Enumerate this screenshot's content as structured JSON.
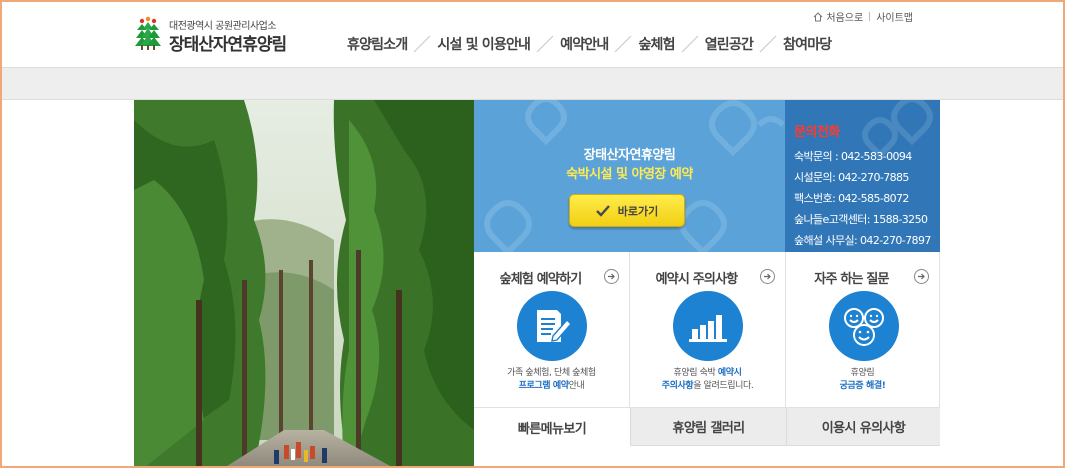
{
  "header": {
    "org_subtitle": "대전광역시 공원관리사업소",
    "site_title": "장태산자연휴양림",
    "util_links": {
      "home": "처음으로",
      "sitemap": "사이트맵"
    },
    "nav": [
      "휴양림소개",
      "시설 및 이용안내",
      "예약안내",
      "숲체험",
      "열린공간",
      "참여마당"
    ]
  },
  "reservation_banner": {
    "line1": "장태산자연휴양림",
    "line2": "숙박시설 및 야영장 예약",
    "button_label": "바로가기",
    "accent_color": "#ffea55"
  },
  "contact": {
    "title": "문의전화",
    "rows": [
      "숙박문의 : 042-583-0094",
      "시설문의: 042-270-7885",
      "팩스번호: 042-585-8072",
      "숲나들e고객센터: 1588-3250",
      "숲해설 사무실: 042-270-7897"
    ]
  },
  "quick_boxes": [
    {
      "title": "숲체험 예약하기",
      "icon": "document-pen-icon",
      "desc_line1": "가족 숲체험, 단체 숲체험",
      "desc_hl": "프로그램 예약",
      "desc_tail": "안내"
    },
    {
      "title": "예약시 주의사항",
      "icon": "bar-chart-icon",
      "desc_line1_pre": "휴양림 숙박 ",
      "desc_line1_hl": "예약시",
      "desc_hl": "주의사항",
      "desc_tail": "을 알려드립니다."
    },
    {
      "title": "자주 하는 질문",
      "icon": "smiley-faces-icon",
      "desc_line1": "휴양림",
      "desc_hl": "궁금증 해결!",
      "desc_tail": ""
    }
  ],
  "tabs": [
    "빠른메뉴보기",
    "휴양림 갤러리",
    "이용시 유의사항"
  ],
  "colors": {
    "banner_blue": "#5aa2d8",
    "contact_blue": "#3177b8",
    "icon_blue": "#1d82d2",
    "contact_title_red": "#ff3a2a"
  }
}
